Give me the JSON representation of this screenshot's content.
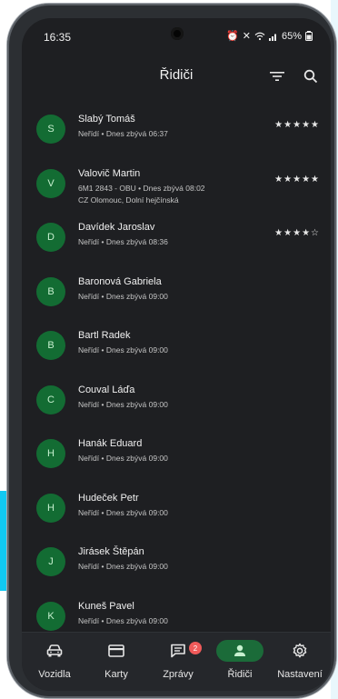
{
  "status_bar": {
    "time": "16:35",
    "battery": "65%"
  },
  "app_bar": {
    "title": "Řidiči"
  },
  "drivers": [
    {
      "initial": "S",
      "name": "Slabý Tomáš",
      "subtitle": "Neřídí • Dnes zbývá 06:37",
      "subtitle2": "",
      "rating": "★★★★★"
    },
    {
      "initial": "V",
      "name": "Valovič Martin",
      "subtitle": "6M1 2843 - OBU • Dnes zbývá 08:02",
      "subtitle2": "CZ Olomouc, Dolní hejčínská",
      "rating": "★★★★★"
    },
    {
      "initial": "D",
      "name": "Davídek Jaroslav",
      "subtitle": "Neřídí • Dnes zbývá 08:36",
      "subtitle2": "",
      "rating": "★★★★☆"
    },
    {
      "initial": "B",
      "name": "Baronová Gabriela",
      "subtitle": "Neřídí • Dnes zbývá 09:00",
      "subtitle2": "",
      "rating": ""
    },
    {
      "initial": "B",
      "name": "Bartl Radek",
      "subtitle": "Neřídí • Dnes zbývá 09:00",
      "subtitle2": "",
      "rating": ""
    },
    {
      "initial": "C",
      "name": "Couval Láďa",
      "subtitle": "Neřídí • Dnes zbývá 09:00",
      "subtitle2": "",
      "rating": ""
    },
    {
      "initial": "H",
      "name": "Hanák Eduard",
      "subtitle": "Neřídí • Dnes zbývá 09:00",
      "subtitle2": "",
      "rating": ""
    },
    {
      "initial": "H",
      "name": "Hudeček Petr",
      "subtitle": "Neřídí • Dnes zbývá 09:00",
      "subtitle2": "",
      "rating": ""
    },
    {
      "initial": "J",
      "name": "Jirásek Štěpán",
      "subtitle": "Neřídí • Dnes zbývá 09:00",
      "subtitle2": "",
      "rating": ""
    },
    {
      "initial": "K",
      "name": "Kuneš Pavel",
      "subtitle": "Neřídí • Dnes zbývá 09:00",
      "subtitle2": "",
      "rating": ""
    }
  ],
  "bottom_nav": {
    "items": [
      {
        "label": "Vozidla",
        "icon": "car-icon",
        "active": false
      },
      {
        "label": "Karty",
        "icon": "card-icon",
        "active": false
      },
      {
        "label": "Zprávy",
        "icon": "message-icon",
        "active": false,
        "badge": "2"
      },
      {
        "label": "Řidiči",
        "icon": "person-icon",
        "active": true
      },
      {
        "label": "Nastavení",
        "icon": "gear-icon",
        "active": false
      }
    ]
  },
  "colors": {
    "screen_bg": "#1e1f22",
    "avatar_bg": "#136c33",
    "accent_green": "#1b6b39",
    "badge_red": "#f05a5a",
    "cyan": "#11c8f2"
  }
}
